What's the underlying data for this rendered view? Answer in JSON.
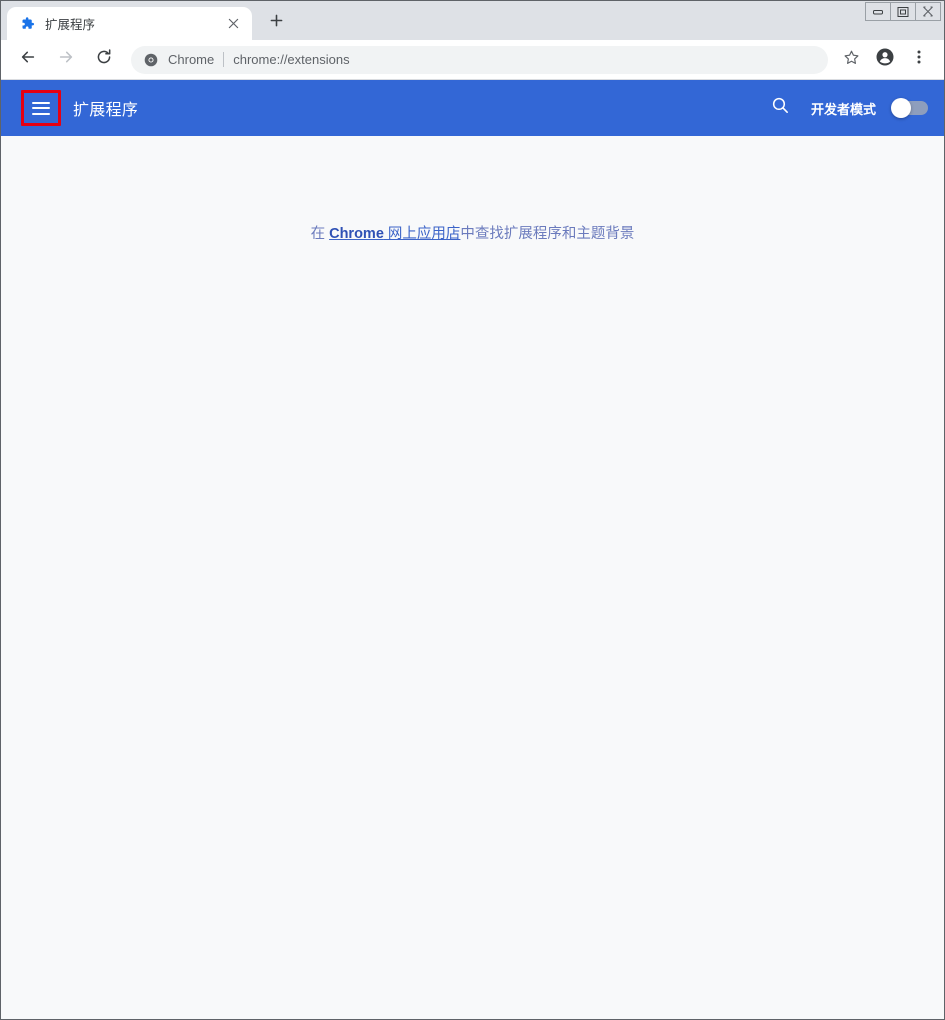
{
  "browser": {
    "tab": {
      "title": "扩展程序",
      "favicon_icon": "puzzle-piece-icon",
      "close_icon": "close-icon"
    },
    "new_tab_icon": "plus-icon",
    "window_controls": {
      "minimize": "minimize-icon",
      "maximize": "maximize-icon",
      "close": "close-icon"
    },
    "nav": {
      "back_icon": "arrow-left-icon",
      "forward_icon": "arrow-right-icon",
      "reload_icon": "reload-icon"
    },
    "omnibox": {
      "site_icon": "chrome-logo-icon",
      "chip_label": "Chrome",
      "url_scheme": "chrome://",
      "url_path": "extensions",
      "url_full": "chrome://extensions"
    },
    "actions": {
      "bookmark_icon": "star-icon",
      "profile_icon": "account-circle-icon",
      "menu_icon": "three-dots-menu-icon"
    }
  },
  "extensions_page": {
    "header": {
      "menu_icon": "hamburger-menu-icon",
      "title": "扩展程序",
      "search_icon": "search-icon",
      "developer_mode_label": "开发者模式",
      "developer_mode_on": false
    },
    "empty_state": {
      "prefix": "在 ",
      "link_brand": "Chrome",
      "link_rest": " 网上应用店",
      "suffix": "中查找扩展程序和主题背景",
      "full_text": "在 Chrome 网上应用店中查找扩展程序和主题背景"
    }
  },
  "colors": {
    "header_blue": "#3367d6",
    "page_background": "#f8f9fa",
    "highlight_red": "#e60012",
    "link_blue": "#3c64c8",
    "tabstrip_gray": "#dee1e6"
  }
}
